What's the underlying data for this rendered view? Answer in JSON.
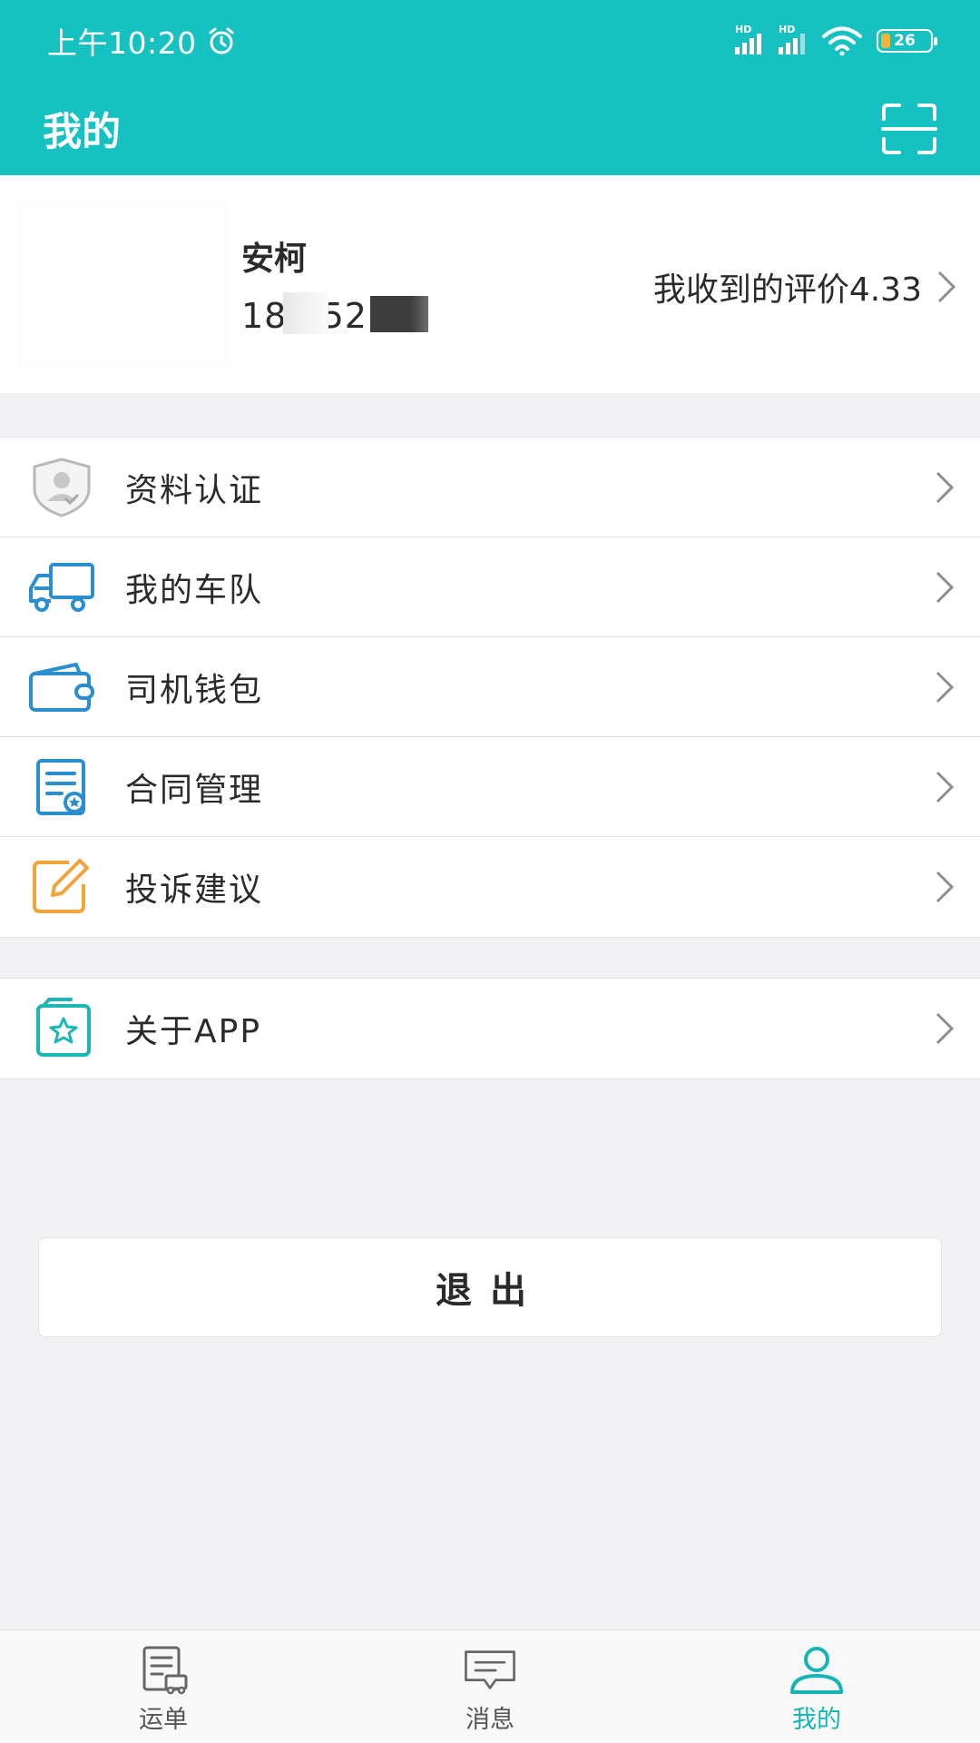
{
  "status_bar": {
    "time": "上午10:20",
    "signal_1_label": "HD",
    "signal_2_label": "HD",
    "battery": "26"
  },
  "header": {
    "title": "我的"
  },
  "profile": {
    "name": "安柯",
    "phone": "182        521",
    "rating_label": "我收到的评价4.33"
  },
  "menu_group_1": [
    {
      "label": "资料认证",
      "icon": "id-verify-icon"
    },
    {
      "label": "我的车队",
      "icon": "truck-icon"
    },
    {
      "label": "司机钱包",
      "icon": "wallet-icon"
    },
    {
      "label": "合同管理",
      "icon": "contract-icon"
    },
    {
      "label": "投诉建议",
      "icon": "edit-icon"
    }
  ],
  "menu_group_2": [
    {
      "label": "关于APP",
      "icon": "app-star-icon"
    }
  ],
  "logout": {
    "label": "退出"
  },
  "bottom_nav": [
    {
      "label": "运单",
      "icon": "waybill-icon",
      "active": false
    },
    {
      "label": "消息",
      "icon": "message-icon",
      "active": false
    },
    {
      "label": "我的",
      "icon": "person-icon",
      "active": true
    }
  ],
  "colors": {
    "accent": "#16c1c1",
    "active_tab": "#16b5b5",
    "blue_icon": "#2a8fd0",
    "orange_icon": "#f2a43a",
    "teal_icon": "#1bb7b7",
    "gray_icon": "#b9b9b9",
    "background": "#f1f1f4"
  }
}
